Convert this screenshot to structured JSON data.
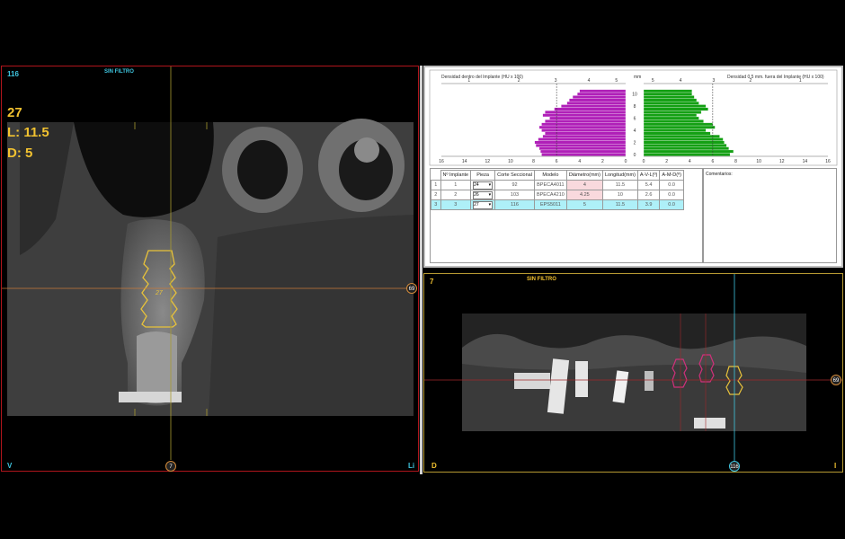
{
  "left_view": {
    "slice_number": "116",
    "filter_label": "SIN FILTRO",
    "tooth": "27",
    "length": "L: 11.5",
    "diameter": "D: 5",
    "corner_bl": "V",
    "corner_br": "Li",
    "marker_bottom": "7",
    "marker_right": "69",
    "implant_label": "27"
  },
  "density_chart": {
    "left_title": "Densidad dentro del Implante (HU x 100)",
    "right_title": "Densidad 0.5 mm. fuera del Implante (HU x 100)",
    "mm_label": "mm",
    "left_top_ticks": [
      "1",
      "2",
      "3",
      "4",
      "5"
    ],
    "right_top_ticks": [
      "5",
      "4",
      "3",
      "2",
      "1"
    ],
    "left_bottom_ticks": [
      "16",
      "14",
      "12",
      "10",
      "8",
      "6",
      "4",
      "2",
      "0"
    ],
    "right_bottom_ticks": [
      "0",
      "2",
      "4",
      "6",
      "8",
      "10",
      "12",
      "14",
      "16"
    ],
    "mm_ticks": [
      "10",
      "8",
      "6",
      "4",
      "2",
      "0"
    ],
    "colors": {
      "inside": "#b020b8",
      "outside": "#14a014"
    }
  },
  "chart_data": {
    "type": "bar",
    "orientation": "horizontal",
    "depth_mm": [
      10.5,
      10,
      9.5,
      9,
      8.5,
      8,
      7.5,
      7,
      6.5,
      6,
      5.5,
      5,
      4.5,
      4,
      3.5,
      3,
      2.5,
      2,
      1.5,
      1,
      0.5,
      0
    ],
    "series": [
      {
        "name": "Densidad dentro del Implante (HU x 100)",
        "values": [
          4.0,
          4.2,
          4.6,
          4.9,
          5.1,
          5.6,
          6.2,
          7.0,
          7.2,
          6.6,
          7.0,
          7.3,
          7.5,
          7.3,
          7.0,
          7.2,
          7.6,
          7.9,
          7.8,
          7.5,
          7.4,
          7.3
        ]
      },
      {
        "name": "Densidad 0.5 mm. fuera del Implante (HU x 100)",
        "values": [
          4.2,
          4.2,
          4.4,
          4.6,
          4.8,
          5.4,
          5.6,
          5.0,
          4.6,
          4.8,
          5.2,
          6.0,
          6.2,
          5.4,
          5.8,
          6.6,
          6.9,
          7.0,
          7.2,
          7.4,
          7.8,
          7.5
        ]
      }
    ],
    "xlim": [
      0,
      16
    ],
    "ylim": [
      0,
      11
    ]
  },
  "implant_table": {
    "headers": [
      "Nº Implante",
      "Pieza",
      "Corte Seccional",
      "Modelo",
      "Diámetro(mm)",
      "Longitud(mm)",
      "A-V-L(º)",
      "A-M-D(º)"
    ],
    "rows": [
      {
        "index": "1",
        "num": "1",
        "pieza": "24",
        "corte": "92",
        "modelo": "BPECA4011",
        "diametro": "4",
        "longitud": "11.5",
        "avl": "5.4",
        "amd": "0.0"
      },
      {
        "index": "2",
        "num": "2",
        "pieza": "26",
        "corte": "103",
        "modelo": "BPECA4210",
        "diametro": "4.25",
        "longitud": "10",
        "avl": "2.6",
        "amd": "0.0"
      },
      {
        "index": "3",
        "num": "3",
        "pieza": "27",
        "corte": "116",
        "modelo": "EPS5011",
        "diametro": "5",
        "longitud": "11.5",
        "avl": "3.9",
        "amd": "0.0"
      }
    ],
    "comments_label": "Comentarios:"
  },
  "bottom_view": {
    "slice_number": "7",
    "filter_label": "SIN FILTRO",
    "corner_bl": "D",
    "corner_br": "I",
    "marker_bottom": "116",
    "marker_right": "69"
  }
}
